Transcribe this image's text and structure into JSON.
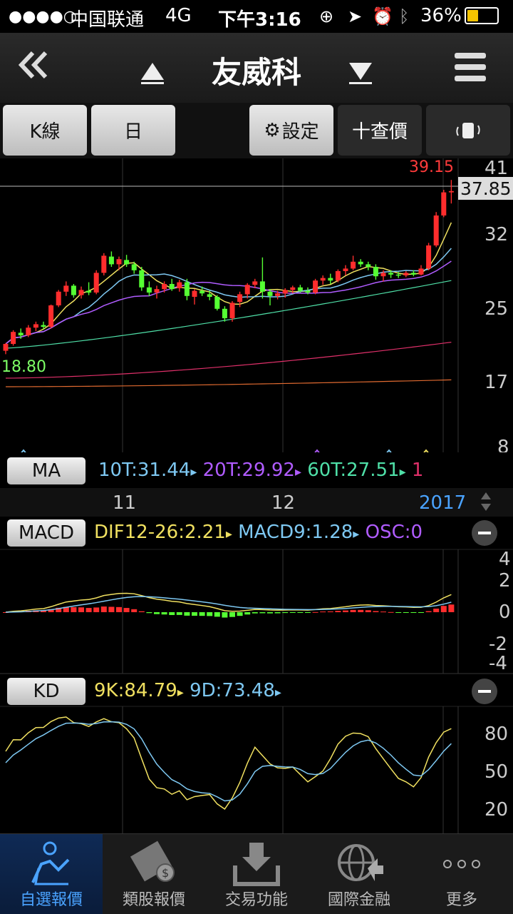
{
  "status": {
    "signal": "●●●●○",
    "carrier": "中国联通",
    "network": "4G",
    "time": "下午3:16",
    "battery": "36%"
  },
  "nav": {
    "title": "友威科",
    "back_icon": "double-chevron-left-icon",
    "prev_icon": "triangle-up-icon",
    "next_icon": "triangle-down-icon",
    "menu_icon": "hamburger-menu-icon"
  },
  "toolbar": {
    "kline": "K線",
    "period": "日",
    "settings": "設定",
    "quote": "十查價",
    "rotate_icon": "rotate-device-icon"
  },
  "main_chart": {
    "high_label": "39.15",
    "low_label": "18.80",
    "current_price": "37.85",
    "y_ticks": [
      "41",
      "32",
      "25",
      "17",
      "8"
    ],
    "x_ticks": [
      "11",
      "12",
      "2017"
    ],
    "ma_legend": {
      "label": "MA",
      "ma10": "10T:31.44",
      "ma20": "20T:29.92",
      "ma60": "60T:27.51",
      "more": "1"
    }
  },
  "macd": {
    "label": "MACD",
    "dif": "DIF12-26:2.21",
    "macd9": "MACD9:1.28",
    "osc": "OSC:0",
    "y_ticks": [
      "4",
      "2",
      "0",
      "-2",
      "-4"
    ]
  },
  "kd": {
    "label": "KD",
    "k": "9K:84.79",
    "d": "9D:73.48",
    "y_ticks": [
      "80",
      "50",
      "20"
    ]
  },
  "colors": {
    "up": "#ff2d2d",
    "down": "#55ff33",
    "ma5": "#f0e060",
    "ma10": "#7ec8f2",
    "ma20": "#b05cff",
    "ma60": "#4fe0a8",
    "ma120": "#e0306a",
    "ma240": "#e06a30",
    "accent": "#4aa3ff"
  },
  "tabs": [
    {
      "label": "自選報價",
      "icon": "person-chart-icon",
      "active": true
    },
    {
      "label": "類股報價",
      "icon": "film-coin-icon",
      "active": false
    },
    {
      "label": "交易功能",
      "icon": "download-tray-icon",
      "active": false
    },
    {
      "label": "國際金融",
      "icon": "globe-arrow-icon",
      "active": false
    },
    {
      "label": "更多",
      "icon": "more-dots-icon",
      "active": false
    }
  ],
  "chart_data": [
    {
      "type": "candlestick",
      "title": "",
      "ylim": [
        8,
        41
      ],
      "x_ticks": [
        "11",
        "12",
        "2017"
      ],
      "high": 39.15,
      "low": 18.8,
      "last": 37.85,
      "candles": [
        [
          19.2,
          20.1,
          18.8,
          20.0
        ],
        [
          20.0,
          21.6,
          19.8,
          21.4
        ],
        [
          21.3,
          21.8,
          20.6,
          21.0
        ],
        [
          21.0,
          22.2,
          20.8,
          21.9
        ],
        [
          21.9,
          22.6,
          21.5,
          22.3
        ],
        [
          22.2,
          22.6,
          21.7,
          22.0
        ],
        [
          22.0,
          24.6,
          21.8,
          24.5
        ],
        [
          24.5,
          26.3,
          24.3,
          26.1
        ],
        [
          26.1,
          27.3,
          25.6,
          26.8
        ],
        [
          26.8,
          27.0,
          25.4,
          25.7
        ],
        [
          25.7,
          26.7,
          25.3,
          26.3
        ],
        [
          26.2,
          27.2,
          25.7,
          26.0
        ],
        [
          26.0,
          28.6,
          25.8,
          28.3
        ],
        [
          28.3,
          30.6,
          28.0,
          30.3
        ],
        [
          30.2,
          30.8,
          29.0,
          29.3
        ],
        [
          29.3,
          30.2,
          28.6,
          29.9
        ],
        [
          29.8,
          30.4,
          29.0,
          29.3
        ],
        [
          29.3,
          29.6,
          28.2,
          28.6
        ],
        [
          28.6,
          29.0,
          26.2,
          26.6
        ],
        [
          26.6,
          27.3,
          25.6,
          26.0
        ],
        [
          26.0,
          26.8,
          25.3,
          26.4
        ],
        [
          26.4,
          27.3,
          26.0,
          27.0
        ],
        [
          27.0,
          27.6,
          26.2,
          26.4
        ],
        [
          26.5,
          27.5,
          26.1,
          27.2
        ],
        [
          27.2,
          27.6,
          25.1,
          25.6
        ],
        [
          25.5,
          26.4,
          24.6,
          26.2
        ],
        [
          26.2,
          26.7,
          25.6,
          25.9
        ],
        [
          25.8,
          26.2,
          25.1,
          25.5
        ],
        [
          25.5,
          25.7,
          23.9,
          24.1
        ],
        [
          24.1,
          24.4,
          22.6,
          23.0
        ],
        [
          23.0,
          25.0,
          22.6,
          24.8
        ],
        [
          24.9,
          26.1,
          24.3,
          25.8
        ],
        [
          25.8,
          27.1,
          25.3,
          26.9
        ],
        [
          26.9,
          27.6,
          26.5,
          27.3
        ],
        [
          27.3,
          30.1,
          25.3,
          26.1
        ],
        [
          26.1,
          26.4,
          24.5,
          25.6
        ],
        [
          25.6,
          26.2,
          25.2,
          25.9
        ],
        [
          25.9,
          26.5,
          25.4,
          26.3
        ],
        [
          26.3,
          26.8,
          25.9,
          26.6
        ],
        [
          26.6,
          26.9,
          26.0,
          26.2
        ],
        [
          26.2,
          26.6,
          25.8,
          26.0
        ],
        [
          26.0,
          27.6,
          25.8,
          27.4
        ],
        [
          27.4,
          28.0,
          26.9,
          27.7
        ],
        [
          27.7,
          28.2,
          27.0,
          27.4
        ],
        [
          27.4,
          28.7,
          27.2,
          28.5
        ],
        [
          28.5,
          29.2,
          28.0,
          28.8
        ],
        [
          28.8,
          30.3,
          28.6,
          29.6
        ],
        [
          29.6,
          29.9,
          29.0,
          29.3
        ],
        [
          29.3,
          29.6,
          28.6,
          29.0
        ],
        [
          29.0,
          29.3,
          27.5,
          27.9
        ],
        [
          27.9,
          28.6,
          27.3,
          28.3
        ],
        [
          28.3,
          28.6,
          27.7,
          28.1
        ],
        [
          28.1,
          28.4,
          27.7,
          28.0
        ],
        [
          28.0,
          28.5,
          27.8,
          28.3
        ],
        [
          28.3,
          28.6,
          27.9,
          28.1
        ],
        [
          28.1,
          29.2,
          28.0,
          28.8
        ],
        [
          28.8,
          31.8,
          28.6,
          31.5
        ],
        [
          31.5,
          35.4,
          31.3,
          35.0
        ],
        [
          35.0,
          38.0,
          34.8,
          37.7
        ],
        [
          37.7,
          39.15,
          36.4,
          37.85
        ]
      ]
    },
    {
      "type": "macd",
      "ylim": [
        -4,
        4
      ],
      "y_ticks": [
        4,
        2,
        0,
        -2,
        -4
      ]
    },
    {
      "type": "kd",
      "ylim": [
        0,
        100
      ],
      "y_ticks": [
        80,
        50,
        20
      ]
    }
  ]
}
